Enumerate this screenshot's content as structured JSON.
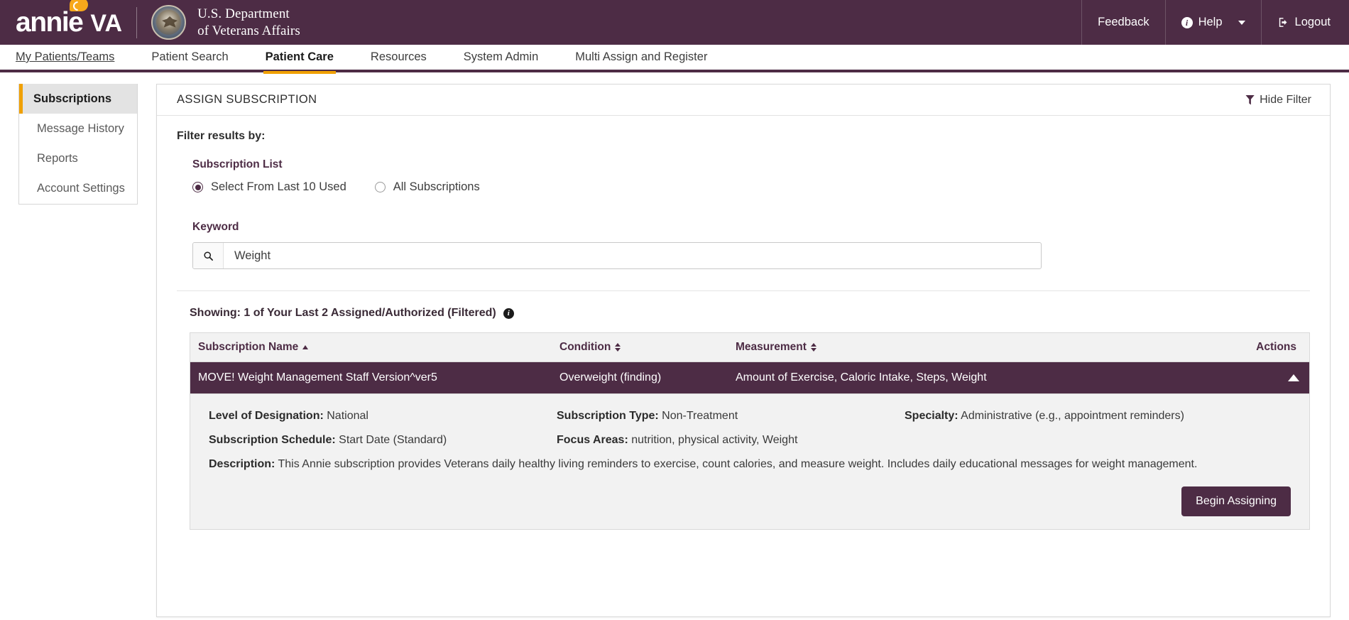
{
  "brand": {
    "app_name_annie": "annie",
    "app_name_va": "VA",
    "dept_line1": "U.S. Department",
    "dept_line2": "of Veterans Affairs",
    "feedback_label": "Feedback",
    "help_label": "Help",
    "logout_label": "Logout",
    "colors": {
      "primary_purple": "#4d2c45",
      "accent_gold": "#f0a000",
      "bubble_orange": "#f7a81b"
    }
  },
  "nav": {
    "items": [
      {
        "label": "My Patients/Teams",
        "state": "link"
      },
      {
        "label": "Patient Search",
        "state": "normal"
      },
      {
        "label": "Patient Care",
        "state": "active"
      },
      {
        "label": "Resources",
        "state": "normal"
      },
      {
        "label": "System Admin",
        "state": "normal"
      },
      {
        "label": "Multi Assign and Register",
        "state": "normal"
      }
    ]
  },
  "sidebar": {
    "items": [
      {
        "label": "Subscriptions",
        "active": true
      },
      {
        "label": "Message History",
        "active": false
      },
      {
        "label": "Reports",
        "active": false
      },
      {
        "label": "Account Settings",
        "active": false
      }
    ]
  },
  "panel": {
    "title": "ASSIGN SUBSCRIPTION",
    "hide_filter_label": "Hide Filter"
  },
  "filter": {
    "heading": "Filter results by:",
    "subscription_list_label": "Subscription List",
    "radios": [
      {
        "label": "Select From Last 10 Used",
        "selected": true
      },
      {
        "label": "All Subscriptions",
        "selected": false
      }
    ],
    "keyword_label": "Keyword",
    "keyword_value": "Weight",
    "keyword_placeholder": "Keyword"
  },
  "results": {
    "showing_text": "Showing: 1 of Your Last 2 Assigned/Authorized (Filtered)",
    "columns": [
      {
        "label": "Subscription Name",
        "sort": "asc"
      },
      {
        "label": "Condition",
        "sort": "none"
      },
      {
        "label": "Measurement",
        "sort": "none"
      },
      {
        "label": "Actions",
        "sort": ""
      }
    ],
    "row": {
      "name": "MOVE! Weight Management Staff Version^ver5",
      "condition": "Overweight (finding)",
      "measurement": "Amount of Exercise, Caloric Intake, Steps, Weight",
      "expanded": true
    },
    "detail": {
      "level_of_designation_label": "Level of Designation:",
      "level_of_designation_value": "National",
      "subscription_type_label": "Subscription Type:",
      "subscription_type_value": "Non-Treatment",
      "specialty_label": "Specialty:",
      "specialty_value": "Administrative (e.g., appointment reminders)",
      "subscription_schedule_label": "Subscription Schedule:",
      "subscription_schedule_value": "Start Date (Standard)",
      "focus_areas_label": "Focus Areas:",
      "focus_areas_value": "nutrition, physical activity, Weight",
      "description_label": "Description:",
      "description_value": "This Annie subscription provides Veterans daily healthy living reminders to exercise, count calories, and measure weight. Includes daily educational messages for weight management.",
      "begin_assigning_label": "Begin Assigning"
    }
  }
}
